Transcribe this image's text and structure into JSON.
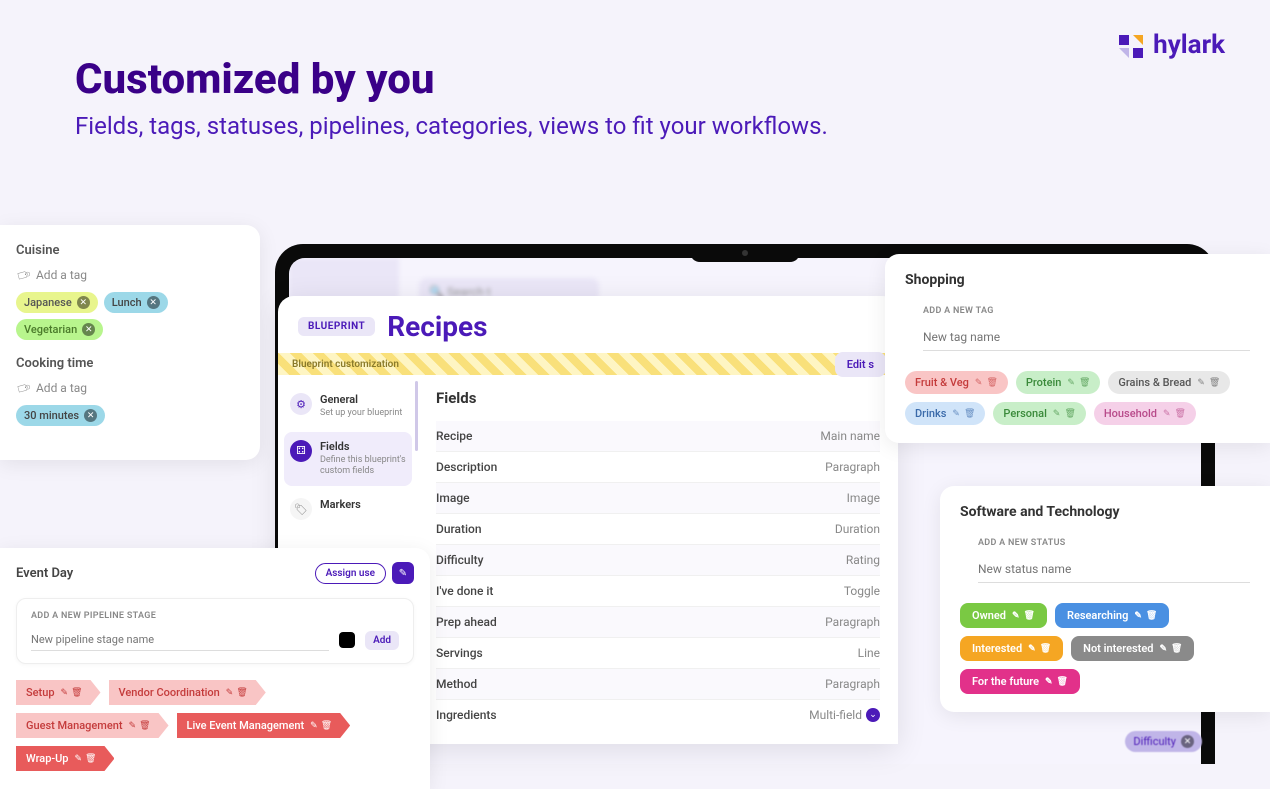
{
  "hero": {
    "title": "Customized by you",
    "subtitle": "Fields, tags, statuses, pipelines, categories, views to fit your workflows."
  },
  "brand": {
    "name": "hylark"
  },
  "cuisine_card": {
    "field1_label": "Cuisine",
    "field2_label": "Cooking time",
    "add_tag_text": "Add a tag",
    "tags1": {
      "japanese": "Japanese",
      "lunch": "Lunch",
      "vegetarian": "Vegetarian"
    },
    "tags2": {
      "thirty": "30 minutes"
    }
  },
  "laptop": {
    "search_placeholder": "Search t"
  },
  "recipes": {
    "badge": "BLUEPRINT",
    "title": "Recipes",
    "stripe": "Blueprint customization",
    "edit_btn": "Edit s",
    "nav": {
      "general": {
        "title": "General",
        "desc": "Set up your blueprint"
      },
      "fields": {
        "title": "Fields",
        "desc": "Define this blueprint's custom fields"
      },
      "markers": {
        "title": "Markers"
      }
    },
    "fields_heading": "Fields",
    "rows": [
      {
        "name": "Recipe",
        "type": "Main name"
      },
      {
        "name": "Description",
        "type": "Paragraph"
      },
      {
        "name": "Image",
        "type": "Image"
      },
      {
        "name": "Duration",
        "type": "Duration"
      },
      {
        "name": "Difficulty",
        "type": "Rating"
      },
      {
        "name": "I've done it",
        "type": "Toggle"
      },
      {
        "name": "Prep ahead",
        "type": "Paragraph"
      },
      {
        "name": "Servings",
        "type": "Line"
      },
      {
        "name": "Method",
        "type": "Paragraph"
      },
      {
        "name": "Ingredients",
        "type": "Multi-field"
      }
    ]
  },
  "pipeline": {
    "title": "Event Day",
    "assign_btn": "Assign use",
    "add_label": "ADD A NEW PIPELINE STAGE",
    "add_placeholder": "New pipeline stage name",
    "add_btn": "Add",
    "stages": {
      "setup": "Setup",
      "vendor": "Vendor Coordination",
      "guest": "Guest Management",
      "live": "Live Event Management",
      "wrap": "Wrap-Up"
    }
  },
  "shopping": {
    "title": "Shopping",
    "add_label": "ADD A NEW TAG",
    "add_placeholder": "New tag name",
    "tags": {
      "fruit": "Fruit & Veg",
      "protein": "Protein",
      "grains": "Grains & Bread",
      "drinks": "Drinks",
      "personal": "Personal",
      "household": "Household"
    }
  },
  "software": {
    "title": "Software and Technology",
    "add_label": "ADD A NEW STATUS",
    "add_placeholder": "New status name",
    "statuses": {
      "owned": "Owned",
      "research": "Researching",
      "interested": "Interested",
      "notint": "Not interested",
      "future": "For the future"
    }
  },
  "difficulty_snippet": "Difficulty"
}
